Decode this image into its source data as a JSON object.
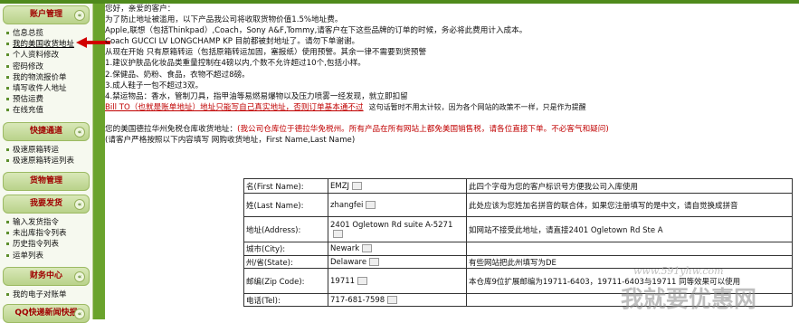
{
  "sidebar": {
    "sections": [
      {
        "title": "账户管理",
        "items": [
          "信息总揽",
          "我的美国收货地址",
          "个人资料修改",
          "密码修改",
          "我的物流报价单",
          "填写收件人地址",
          "预估运费",
          "在线充值"
        ]
      },
      {
        "title": "快捷通道",
        "items": [
          "极速原箱转运",
          "极速原箱转运列表"
        ]
      },
      {
        "title": "货物管理",
        "items": []
      },
      {
        "title": "我要发货",
        "items": [
          "输入发货指令",
          "未出库指令列表",
          "历史指令列表",
          "运单列表"
        ]
      },
      {
        "title": "财务中心",
        "items": [
          "我的电子对账单"
        ]
      },
      {
        "title": "QQ快递新闻快报",
        "items": []
      }
    ],
    "toggle_glyph": "«"
  },
  "main": {
    "greeting": "您好，亲爱的客户：",
    "line1": "为了防止地址被滥用，以下产品我公司将收取货物价值1.5%地址费。",
    "line2": "Apple,联想（包括Thinkpad）,Coach，Sony A&F,Tommy,请客户在下这些品牌的订单的时候，务必将此费用计入成本。",
    "line3": "Coach GUCCI LV LONGCHAMP KP 目前都被封地址了。请勿下单谢谢。",
    "line4": "从现在开始 只有原箱转运（包括原箱转运加固，塞报纸）使用预警。其余一律不需要到货预警",
    "line5": "1.建议护肤品化妆品类重量控制在4磅以内,个数不允许超过10个,包括小样。",
    "line6": "2.保健品、奶粉、食品，衣物不超过8磅。",
    "line7": "3.成人鞋子一包不超过3双。",
    "line8": "4.禁运物品：香水，管制刀具，指甲油等易燃易爆物以及压力喷雾一经发现，就立即扣留",
    "billto_warning": "Bill TO（也就是账单地址）地址只能写自己真实地址，否则订单基本通不过",
    "billto_note": "这句话暂时不用太计较，因为各个网站的政策不一样，只是作为提醒",
    "addr_intro": "您的美国德拉华州免税仓库收货地址：",
    "addr_red": "(我公司仓库位于德拉华免税州。所有产品在所有网站上都免美国销售税，请各位直接下单。不必客气和疑问)",
    "addr_hint": "(请客户严格按照以下内容填写 网购收货地址，First Name,Last Name)"
  },
  "address_table": {
    "rows": [
      {
        "label": "名(First Name):",
        "value": "EMZJ",
        "note": "此四个字母为您的客户标识号方便我公司入库使用"
      },
      {
        "label": "姓(Last Name):",
        "value": "zhangfei",
        "note": "此处应该为您姓加名拼音的联合体，如果您注册填写的是中文，请自觉换成拼音"
      },
      {
        "label": "地址(Address):",
        "value": "2401 Ogletown Rd suite A-5271",
        "note": "如网站不接受此地址，请直接2401 Ogletown Rd Ste A"
      },
      {
        "label": "城市(City):",
        "value": "Newark",
        "note": ""
      },
      {
        "label": "州/省(State):",
        "value": "Delaware",
        "note": "有些网站把此州填写为DE"
      },
      {
        "label": "邮编(Zip Code):",
        "value": "19711",
        "note": "本仓库9位扩展邮编为19711-6403，19711-6403与19711 同等效果可以使用"
      },
      {
        "label": "电话(Tel):",
        "value": "717-681-7598",
        "note": ""
      }
    ]
  },
  "watermark": {
    "url": "www.591yhw.com",
    "slogan": "我就要优惠网"
  },
  "colors": {
    "header_green": "#4f8a1c",
    "divider_green": "#6aa32c",
    "warning_red": "#c00000"
  }
}
